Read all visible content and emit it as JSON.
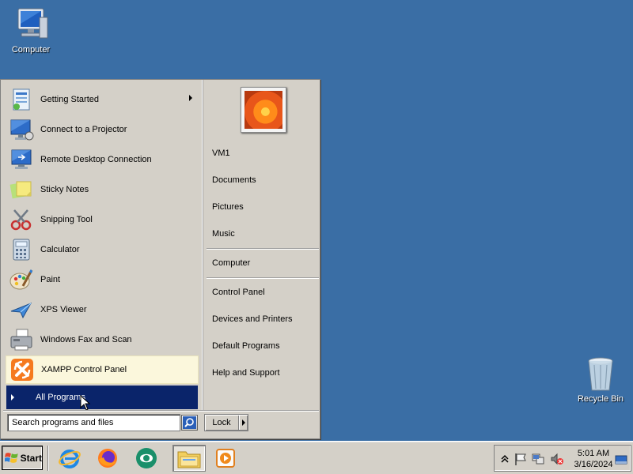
{
  "desktop": {
    "icons": [
      {
        "label": "Computer",
        "icon": "computer-icon"
      },
      {
        "label": "Recycle Bin",
        "icon": "recycle-bin-icon"
      }
    ],
    "background_color": "#3a6ea5"
  },
  "start_menu": {
    "programs": [
      {
        "label": "Getting Started",
        "icon": "getting-started-icon",
        "has_submenu": true
      },
      {
        "label": "Connect to a Projector",
        "icon": "projector-icon"
      },
      {
        "label": "Remote Desktop Connection",
        "icon": "remote-desktop-icon"
      },
      {
        "label": "Sticky Notes",
        "icon": "sticky-notes-icon"
      },
      {
        "label": "Snipping Tool",
        "icon": "snipping-tool-icon"
      },
      {
        "label": "Calculator",
        "icon": "calculator-icon"
      },
      {
        "label": "Paint",
        "icon": "paint-icon"
      },
      {
        "label": "XPS Viewer",
        "icon": "xps-viewer-icon"
      },
      {
        "label": "Windows Fax and Scan",
        "icon": "fax-scan-icon"
      },
      {
        "label": "XAMPP Control Panel",
        "icon": "xampp-icon",
        "highlighted": true
      }
    ],
    "all_programs_label": "All Programs",
    "search": {
      "placeholder": "Search programs and files",
      "value": ""
    },
    "right_pane": {
      "user_name": "VM1",
      "items_group1": [
        "Documents",
        "Pictures",
        "Music"
      ],
      "items_group2": [
        "Computer"
      ],
      "items_group3": [
        "Control Panel",
        "Devices and Printers",
        "Default Programs",
        "Help and Support"
      ]
    },
    "lock_label": "Lock"
  },
  "taskbar": {
    "start_label": "Start",
    "quick_launch": [
      "internet-explorer-icon",
      "firefox-icon",
      "app-icon",
      "file-explorer-icon",
      "media-player-icon"
    ],
    "tray_icons": [
      "show-hidden-icons-chevron",
      "action-center-flag-icon",
      "network-icon",
      "volume-muted-icon"
    ],
    "clock_time": "5:01 AM",
    "clock_date": "3/16/2024"
  }
}
